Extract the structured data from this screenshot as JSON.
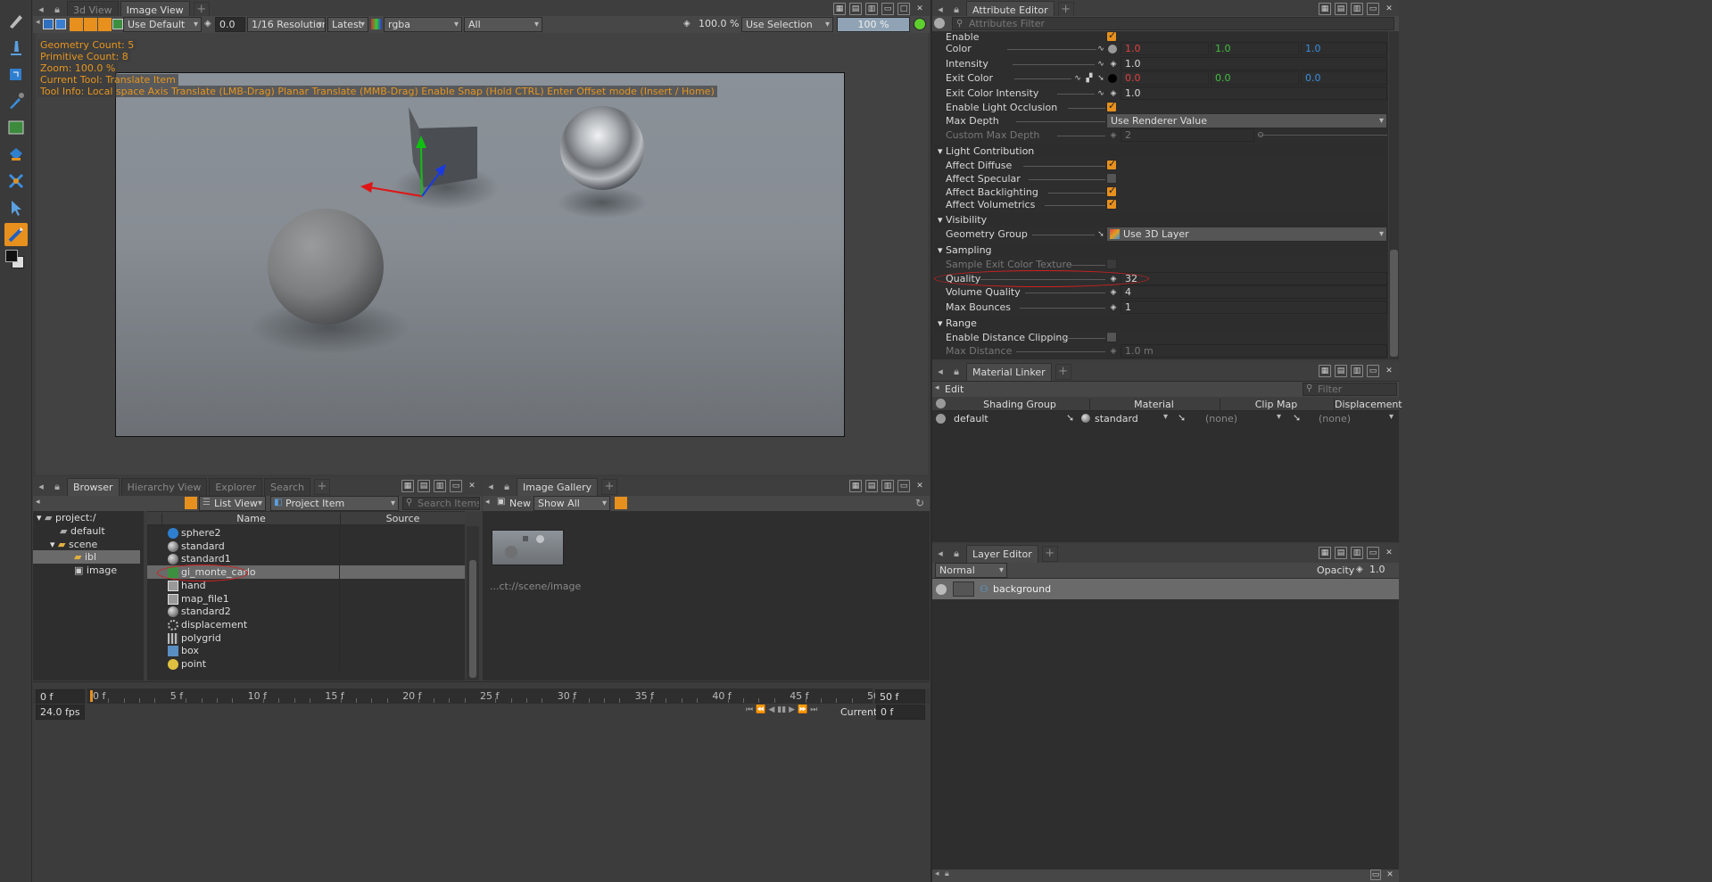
{
  "viewer": {
    "tabs": [
      "3d View",
      "Image View"
    ],
    "active_tab": "Image View",
    "lut": "Use Default",
    "exposure": "0.0",
    "resolution": "1/16 Resolution",
    "frame_mode": "Latest",
    "channels": "rgba",
    "layers": "All",
    "zoom": "100.0 %",
    "selection_mode": "Use Selection",
    "progress": "100 %",
    "progress_fraction": 1.0,
    "hud": [
      "Geometry Count: 5",
      "Primitive Count: 8",
      "Zoom: 100.0 %",
      "Current Tool: Translate Item",
      "Tool Info: Local space Axis Translate (LMB-Drag)  Planar Translate (MMB-Drag)  Enable Snap (Hold CTRL)  Enter Offset mode (Insert / Home)"
    ]
  },
  "attribute_editor": {
    "title": "Attribute Editor",
    "filter_placeholder": "Attributes Filter",
    "enable_label": "Enable",
    "color_label": "Color",
    "color": {
      "r": "1.0",
      "g": "1.0",
      "b": "1.0"
    },
    "intensity_label": "Intensity",
    "intensity": "1.0",
    "exit_color_label": "Exit Color",
    "exit_color": {
      "r": "0.0",
      "g": "0.0",
      "b": "0.0"
    },
    "exit_color_intensity_label": "Exit Color Intensity",
    "exit_color_intensity": "1.0",
    "enable_light_occlusion_label": "Enable Light Occlusion",
    "max_depth_label": "Max Depth",
    "max_depth": "Use Renderer Value",
    "custom_max_depth_label": "Custom Max Depth",
    "custom_max_depth": "2",
    "sections": {
      "light_contribution": "Light Contribution",
      "visibility": "Visibility",
      "sampling": "Sampling",
      "range": "Range"
    },
    "affect_diffuse_label": "Affect Diffuse",
    "affect_specular_label": "Affect Specular",
    "affect_backlighting_label": "Affect Backlighting",
    "affect_volumetrics_label": "Affect Volumetrics",
    "geometry_group_label": "Geometry Group",
    "geometry_group": "Use 3D Layer",
    "sample_exit_color_texture_label": "Sample Exit Color Texture",
    "quality_label": "Quality",
    "quality": "32",
    "volume_quality_label": "Volume Quality",
    "volume_quality": "4",
    "max_bounces_label": "Max Bounces",
    "max_bounces": "1",
    "enable_distance_clipping_label": "Enable Distance Clipping",
    "max_distance_label": "Max Distance",
    "max_distance": "1.0 m"
  },
  "material_linker": {
    "title": "Material Linker",
    "edit_label": "Edit",
    "filter_placeholder": "Filter",
    "columns": [
      "Shading Group",
      "Material",
      "Clip Map",
      "Displacement"
    ],
    "row": {
      "group": "default",
      "material": "standard",
      "clip_map": "(none)",
      "displacement": "(none)"
    }
  },
  "layer_editor": {
    "title": "Layer Editor",
    "blend_mode": "Normal",
    "opacity_label": "Opacity",
    "opacity": "1.0",
    "layer_name": "background"
  },
  "browser": {
    "tabs": [
      "Browser",
      "Hierarchy View",
      "Explorer",
      "Search"
    ],
    "view_mode": "List View",
    "item_filter": "Project Item",
    "search_placeholder": "Search Items",
    "tree": [
      {
        "label": "project:/"
      },
      {
        "label": "default"
      },
      {
        "label": "scene"
      },
      {
        "label": "ibl"
      },
      {
        "label": "image"
      }
    ],
    "columns": [
      "Name",
      "Source"
    ],
    "items": [
      {
        "name": "sphere2",
        "icon": "sphere-geo-icon"
      },
      {
        "name": "standard",
        "icon": "material-ball-icon"
      },
      {
        "name": "standard1",
        "icon": "material-ball-icon"
      },
      {
        "name": "gi_monte_carlo",
        "icon": "light-gi-icon"
      },
      {
        "name": "hand",
        "icon": "texture-icon"
      },
      {
        "name": "map_file1",
        "icon": "texture-icon"
      },
      {
        "name": "standard2",
        "icon": "material-ball-icon"
      },
      {
        "name": "displacement",
        "icon": "gear-icon"
      },
      {
        "name": "polygrid",
        "icon": "grid-icon"
      },
      {
        "name": "box",
        "icon": "box-icon"
      },
      {
        "name": "point",
        "icon": "point-light-icon"
      }
    ]
  },
  "image_gallery": {
    "title": "Image Gallery",
    "new_label": "New",
    "filter": "Show All",
    "thumb_path": "...ct://scene/image"
  },
  "timeline": {
    "start": "0 f",
    "end": "50 f",
    "ticks": [
      "0 f",
      "5 f",
      "10 f",
      "15 f",
      "20 f",
      "25 f",
      "30 f",
      "35 f",
      "40 f",
      "45 f",
      "50 f"
    ],
    "fps": "24.0 fps",
    "current_label": "Current",
    "current": "0 f"
  },
  "colors": {
    "accent": "#e7901e",
    "red": "#e04040",
    "green": "#40c040",
    "blue": "#3a8ee0"
  }
}
